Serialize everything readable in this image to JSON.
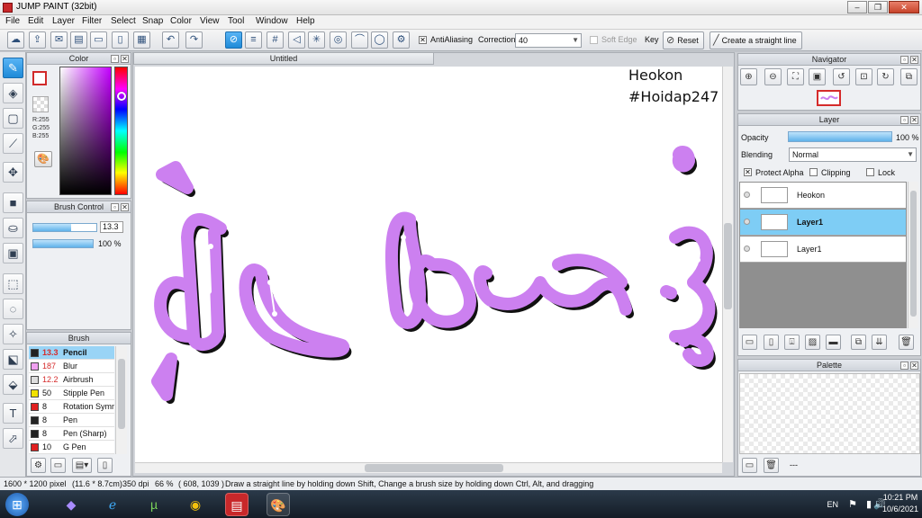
{
  "window": {
    "title": "JUMP PAINT (32bit)"
  },
  "menu": [
    "File",
    "Edit",
    "Layer",
    "Filter",
    "Select",
    "Snap",
    "Color",
    "View",
    "Tool",
    "Window",
    "Help"
  ],
  "toolbar": {
    "antialiasing_label": "AntiAliasing",
    "correction_label": "Correction",
    "correction_value": "40",
    "soft_edge_label": "Soft Edge",
    "key_label": "Key",
    "reset_label": "Reset",
    "straight_line_label": "Create a straight line"
  },
  "color_panel": {
    "title": "Color",
    "r": "R:255",
    "g": "G:255",
    "b": "B:255",
    "hue_color": "#c400ff"
  },
  "brush_control": {
    "title": "Brush Control",
    "size_value": "13.3",
    "opacity_value": "100 %",
    "size_fraction": 0.6,
    "opacity_fraction": 1.0
  },
  "brush_panel": {
    "title": "Brush",
    "items": [
      {
        "size": "13.3",
        "name": "Pencil",
        "color": "#222222",
        "selected": true,
        "size_red": true
      },
      {
        "size": "187",
        "name": "Blur",
        "color": "#f0a0f0",
        "selected": false,
        "size_red": true
      },
      {
        "size": "12.2",
        "name": "Airbrush",
        "color": "#dddddd",
        "selected": false,
        "size_red": true
      },
      {
        "size": "50",
        "name": "Stipple Pen",
        "color": "#f2e200",
        "selected": false,
        "size_red": false
      },
      {
        "size": "8",
        "name": "Rotation Symm",
        "color": "#e02020",
        "selected": false,
        "size_red": false
      },
      {
        "size": "8",
        "name": "Pen",
        "color": "#222222",
        "selected": false,
        "size_red": false
      },
      {
        "size": "8",
        "name": "Pen (Sharp)",
        "color": "#222222",
        "selected": false,
        "size_red": false
      },
      {
        "size": "10",
        "name": "G Pen",
        "color": "#e02020",
        "selected": false,
        "size_red": false
      }
    ]
  },
  "document": {
    "tab_title": "Untitled",
    "canvas_text_1": "Heokon",
    "canvas_text_2": "#Hoidap247",
    "stroke_color": "#cc80f0"
  },
  "navigator": {
    "title": "Navigator"
  },
  "layer_panel": {
    "title": "Layer",
    "opacity_label": "Opacity",
    "opacity_value": "100 %",
    "opacity_fraction": 1.0,
    "blending_label": "Blending",
    "blending_value": "Normal",
    "protect_alpha_label": "Protect Alpha",
    "clipping_label": "Clipping",
    "lock_label": "Lock",
    "layers": [
      {
        "name": "Heokon",
        "selected": false
      },
      {
        "name": "Layer1",
        "selected": true
      },
      {
        "name": "Layer1",
        "selected": false
      }
    ]
  },
  "palette_panel": {
    "title": "Palette",
    "dash": "---"
  },
  "status": {
    "size": "1600 * 1200 pixel",
    "cm": "(11.6 * 8.7cm)",
    "dpi": "350 dpi",
    "zoom": "66 %",
    "coords": "( 608, 1039 )",
    "hint": "Draw a straight line by holding down Shift, Change a brush size by holding down Ctrl, Alt, and dragging"
  },
  "taskbar": {
    "lang": "EN",
    "time": "10:21 PM",
    "date": "10/6/2021"
  }
}
